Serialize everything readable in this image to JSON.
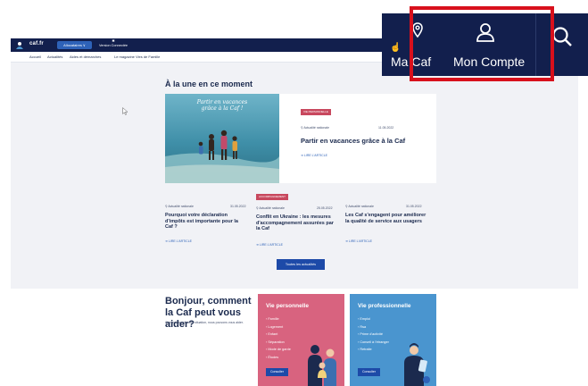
{
  "header": {
    "logo_text": "caf.fr",
    "allocataires_label": "Allocataires ∨",
    "version_label": "Version Connectée"
  },
  "subnav": {
    "items": [
      "Accueil",
      "Actualités",
      "Aides et démarches",
      "Le magazine Vies de Famille"
    ]
  },
  "zoom": {
    "ma_caf_label": "Ma Caf",
    "mon_compte_label": "Mon Compte",
    "cursor_glyph": "☝"
  },
  "headlines": {
    "section_title": "À la une en ce moment",
    "hero": {
      "image_text": "Partir en vacances grâce à la Caf !",
      "badge": "VIE PERSONNELLE",
      "meta": "Actualité nationale",
      "date": "11.05.2022",
      "title": "Partir en vacances grâce à la Caf",
      "read_more": "LIRE L'ARTICLE"
    },
    "news": [
      {
        "badge": "",
        "meta": "Actualité nationale",
        "date": "31.05.2022",
        "title": "Pourquoi votre déclaration d'impôts est importante pour la Caf ?",
        "read_more": "LIRE L'ARTICLE"
      },
      {
        "badge": "ACCOMPAGNEMENT",
        "meta": "Actualité nationale",
        "date": "25.05.2022",
        "title": "Conflit en Ukraine : les mesures d'accompagnement assurées par la Caf",
        "read_more": "LIRE L'ARTICLE"
      },
      {
        "badge": "",
        "meta": "Actualité nationale",
        "date": "31.05.2022",
        "title": "Les Caf s'engagent pour améliorer la qualité de service aux usagers",
        "read_more": "LIRE L'ARTICLE"
      }
    ],
    "all_news_button": "Toutes les actualités"
  },
  "help": {
    "title": "Bonjour, comment la Caf peut vous aider?",
    "subtitle": "Quelle que soit votre situation, nous pouvons vous aider.",
    "cards": [
      {
        "title": "Vie personnelle",
        "items": [
          "Famille",
          "Logement",
          "Enfant",
          "Séparation",
          "Mode de garde",
          "Études"
        ],
        "button": "Consulter"
      },
      {
        "title": "Vie professionnelle",
        "items": [
          "Emploi",
          "Rsa",
          "Prime d'activité",
          "Conseil à l'étranger",
          "Retraite"
        ],
        "button": "Consulter"
      }
    ]
  },
  "colors": {
    "navy": "#121f4d",
    "accent_blue": "#1d4aa8",
    "badge_pink": "#c8485e",
    "card_pink": "#d8637f",
    "card_blue": "#4a95cf",
    "highlight_red": "#d8101c"
  }
}
